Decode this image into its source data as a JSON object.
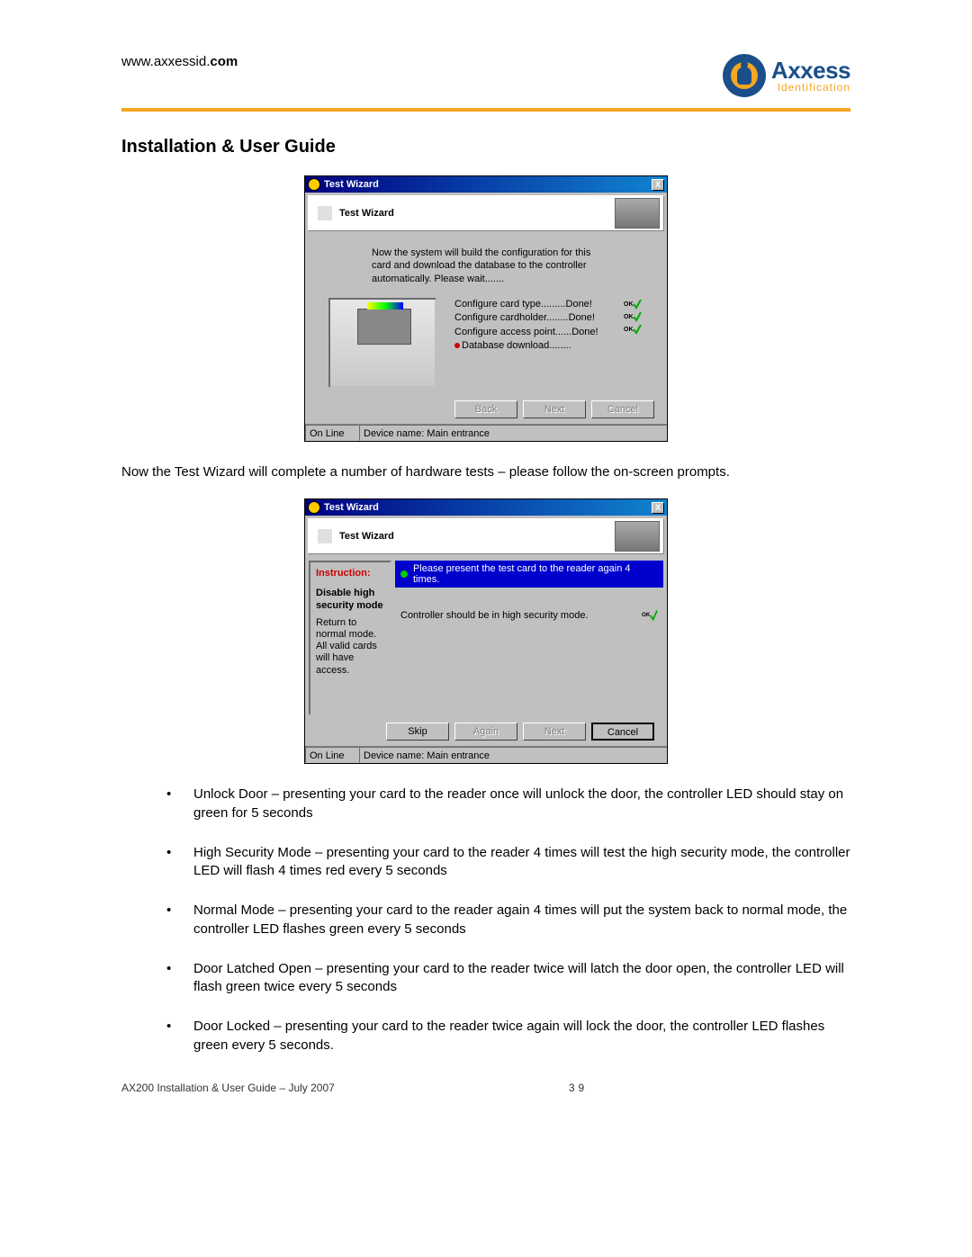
{
  "header": {
    "url_prefix": "www.axxessid.",
    "url_bold": "com",
    "logo_brand": "Axxess",
    "logo_sub": "Identification"
  },
  "title": "Installation & User Guide",
  "wizard1": {
    "titlebar": "Test Wizard",
    "header_title": "Test Wizard",
    "close": "X",
    "message": "Now the system will build the configuration for this card and download the database to the controller automatically. Please wait.......",
    "steps": {
      "s1": "Configure card type.........Done!",
      "s2": "Configure cardholder........Done!",
      "s3": "Configure access point......Done!",
      "s4": "Database download........"
    },
    "ok_label": "OK",
    "buttons": {
      "back": "Back",
      "next": "Next",
      "cancel": "Cancel"
    },
    "status": {
      "online": "On Line",
      "device": "Device name: Main entrance"
    }
  },
  "para1": "Now the Test Wizard will complete a number of hardware tests – please follow the on-screen prompts.",
  "wizard2": {
    "titlebar": "Test Wizard",
    "header_title": "Test Wizard",
    "close": "X",
    "instruction_label": "Instruction:",
    "side_bold": "Disable high security mode",
    "side_text": "Return to normal mode. All valid cards will have access.",
    "banner": "Please present the test card to the reader again 4 times.",
    "mid_text": "Controller should be in high security mode.",
    "ok_label": "OK",
    "buttons": {
      "skip": "Skip",
      "again": "Again",
      "next": "Next",
      "cancel": "Cancel"
    },
    "status": {
      "online": "On Line",
      "device": "Device name: Main entrance"
    }
  },
  "bullets": {
    "b1": "Unlock Door – presenting your card to the reader once will unlock the door, the controller LED should stay on green for 5 seconds",
    "b2": "High Security Mode – presenting your card to the reader 4 times will test the high security mode, the controller LED will flash 4 times red every 5 seconds",
    "b3": "Normal Mode – presenting your card to the reader again 4 times will put the system back to normal mode, the controller LED flashes green every 5 seconds",
    "b4": "Door Latched Open – presenting your card to the reader twice will latch the door open, the controller LED will flash green twice every 5 seconds",
    "b5": "Door Locked – presenting your card to the reader twice again will lock the door, the controller LED flashes green every 5 seconds."
  },
  "footer": {
    "left": "AX200 Installation & User Guide – July 2007",
    "page": "39"
  }
}
